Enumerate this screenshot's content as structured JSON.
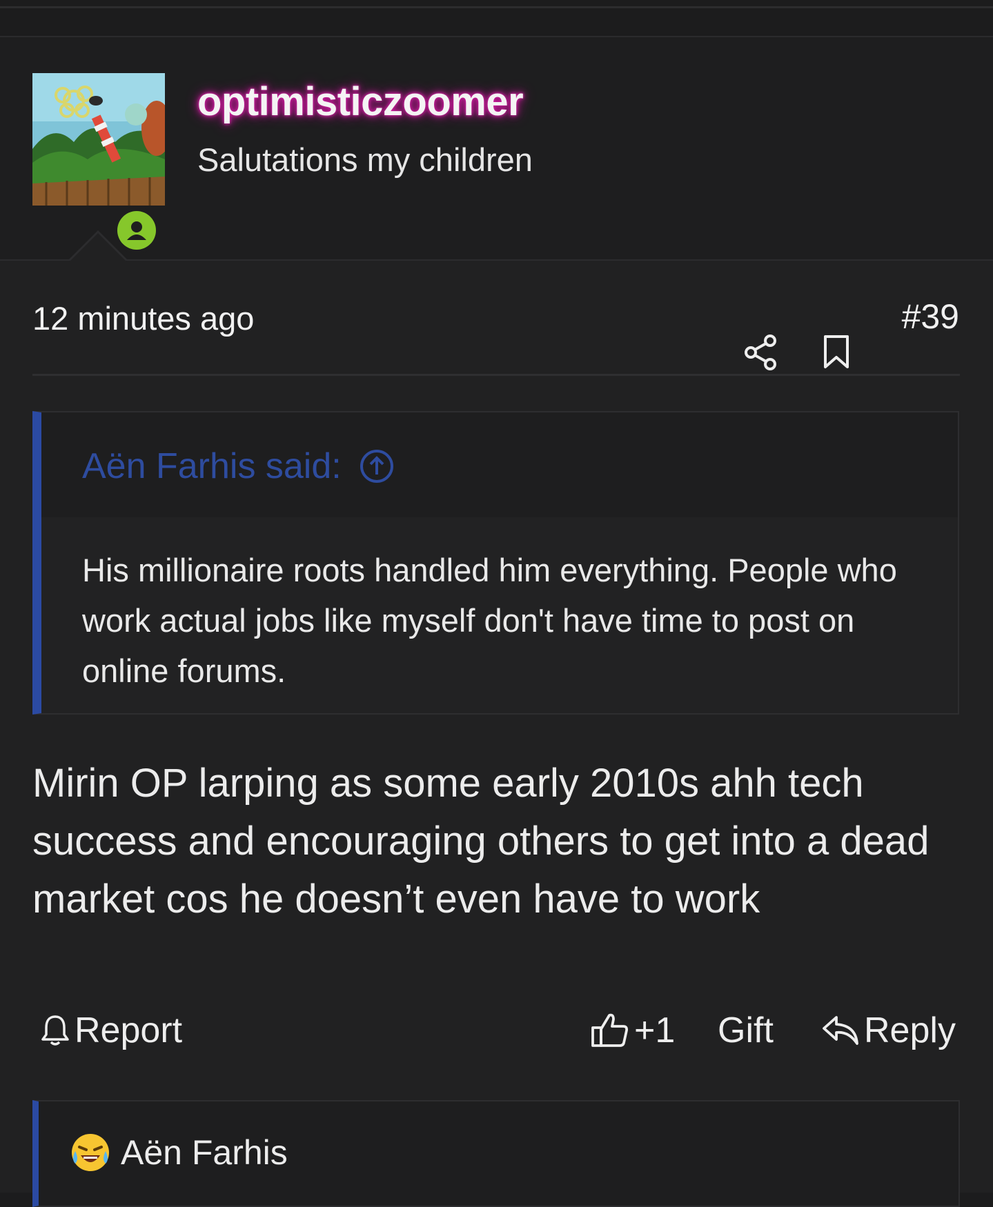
{
  "post": {
    "username": "optimisticzoomer",
    "user_title": "Salutations my children",
    "timestamp": "12 minutes ago",
    "post_number": "#39",
    "quote": {
      "author_line": "Aën Farhis said:",
      "text": "His millionaire roots handled him everything. People who work actual jobs like myself don't have time to post on online forums."
    },
    "message": "Mirin OP larping as some early 2010s ahh tech success and encouraging others to get into a dead market cos he doesn’t even have to work",
    "actions": {
      "report": "Report",
      "like_count": "+1",
      "gift": "Gift",
      "reply": "Reply"
    },
    "reactions": [
      {
        "icon": "laughing-crying-emoji-icon",
        "user": "Aën Farhis"
      }
    ]
  },
  "colors": {
    "background": "#212122",
    "quote_accent": "#2b4aa3",
    "username_glow": "#d21aa0",
    "online": "#86c72b"
  }
}
